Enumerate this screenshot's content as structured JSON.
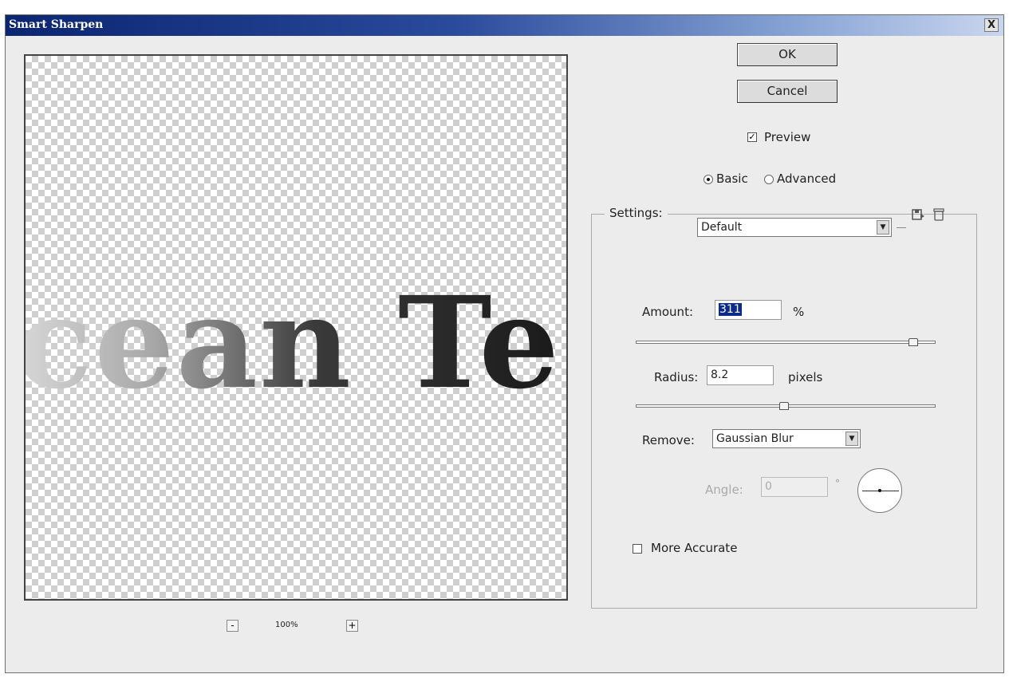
{
  "window": {
    "title": "Smart Sharpen",
    "close_symbol": "X"
  },
  "preview": {
    "text": "cean Te",
    "zoom_minus": "-",
    "zoom_level": "100%",
    "zoom_plus": "+"
  },
  "buttons": {
    "ok": "OK",
    "cancel": "Cancel"
  },
  "preview_checkbox": {
    "label": "Preview",
    "checked": true,
    "mark": "✓"
  },
  "mode": {
    "basic_label": "Basic",
    "advanced_label": "Advanced",
    "selected": "Basic"
  },
  "settings": {
    "label": "Settings:",
    "value": "Default",
    "arrow": "▼"
  },
  "amount": {
    "label": "Amount:",
    "value": "311",
    "unit": "%",
    "slider_fraction": 0.92
  },
  "radius": {
    "label": "Radius:",
    "value": "8.2",
    "unit": "pixels",
    "slider_fraction": 0.49
  },
  "remove": {
    "label": "Remove:",
    "value": "Gaussian Blur",
    "arrow": "▼"
  },
  "angle": {
    "label": "Angle:",
    "value": "0",
    "unit": "°",
    "enabled": false
  },
  "more_accurate": {
    "label": "More Accurate",
    "checked": false
  },
  "icons": {
    "save_settings": "floppy-disk-save-icon",
    "delete_settings": "trash-can-delete-icon"
  },
  "colors": {
    "titlebar_start": "#0b2571",
    "titlebar_end": "#c9d6ee",
    "dialog_bg": "#ececec",
    "selection": "#0b2a8a"
  }
}
